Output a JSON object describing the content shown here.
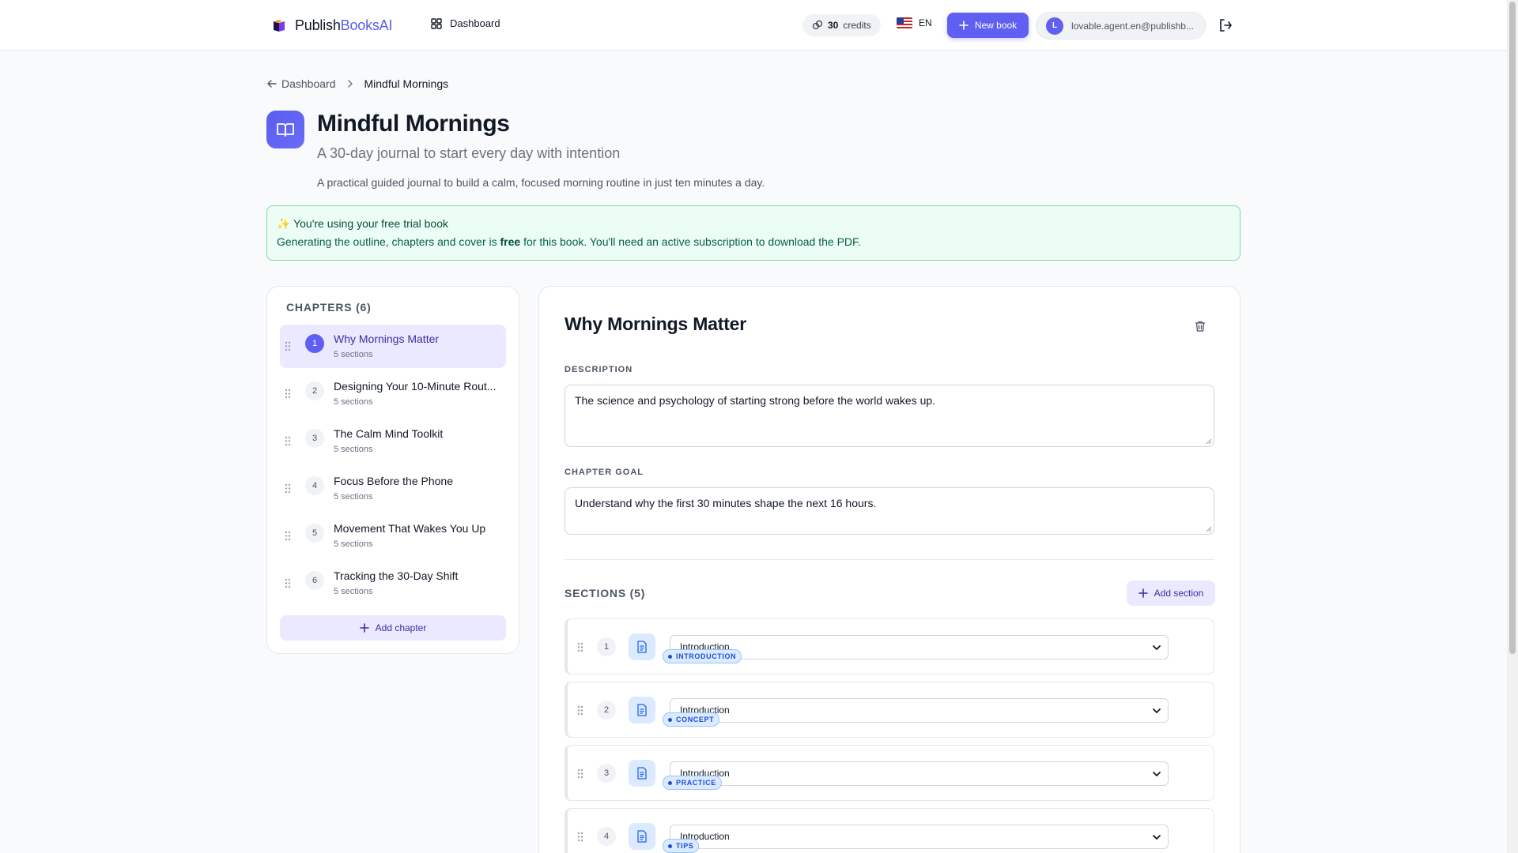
{
  "header": {
    "logo_main": "Publish",
    "logo_accent": "BooksAI",
    "nav_dashboard": "Dashboard",
    "credits_value": "30",
    "credits_label": "credits",
    "lang": "EN",
    "new_book": "New book",
    "avatar_letter": "L",
    "user_email": "lovable.agent.en@publishb..."
  },
  "breadcrumb": {
    "back": "Dashboard",
    "current": "Mindful Mornings"
  },
  "book": {
    "title": "Mindful Mornings",
    "subtitle": "A 30-day journal to start every day with intention",
    "description": "A practical guided journal to build a calm, focused morning routine in just ten minutes a day."
  },
  "trial": {
    "line1": "✨ You're using your free trial book",
    "line2_a": "Generating the outline, chapters and cover is ",
    "line2_b": "free",
    "line2_c": " for this book. You'll need an active subscription to download the PDF."
  },
  "chapters": {
    "heading": "CHAPTERS (6)",
    "add_label": "Add chapter",
    "items": [
      {
        "num": "1",
        "title": "Why Mornings Matter",
        "sub": "5 sections"
      },
      {
        "num": "2",
        "title": "Designing Your 10-Minute Rout...",
        "sub": "5 sections"
      },
      {
        "num": "3",
        "title": "The Calm Mind Toolkit",
        "sub": "5 sections"
      },
      {
        "num": "4",
        "title": "Focus Before the Phone",
        "sub": "5 sections"
      },
      {
        "num": "5",
        "title": "Movement That Wakes You Up",
        "sub": "5 sections"
      },
      {
        "num": "6",
        "title": "Tracking the 30-Day Shift",
        "sub": "5 sections"
      }
    ]
  },
  "editor": {
    "title": "Why Mornings Matter",
    "description_label": "DESCRIPTION",
    "description_value": "The science and psychology of starting strong before the world wakes up.",
    "goal_label": "CHAPTER GOAL",
    "goal_value": "Understand why the first 30 minutes shape the next 16 hours.",
    "sections_heading": "SECTIONS (5)",
    "add_section": "Add section",
    "sections": [
      {
        "num": "1",
        "value": "Introduction",
        "badge": "INTRODUCTION"
      },
      {
        "num": "2",
        "value": "Introduction",
        "badge": "CONCEPT"
      },
      {
        "num": "3",
        "value": "Introduction",
        "badge": "PRACTICE"
      },
      {
        "num": "4",
        "value": "Introduction",
        "badge": "TIPS"
      }
    ]
  },
  "colors": {
    "accent": "#5f5ff2",
    "active_bg": "#ebe9ff",
    "trial_bg": "#ecfdf5",
    "trial_border": "#7ddba8"
  }
}
